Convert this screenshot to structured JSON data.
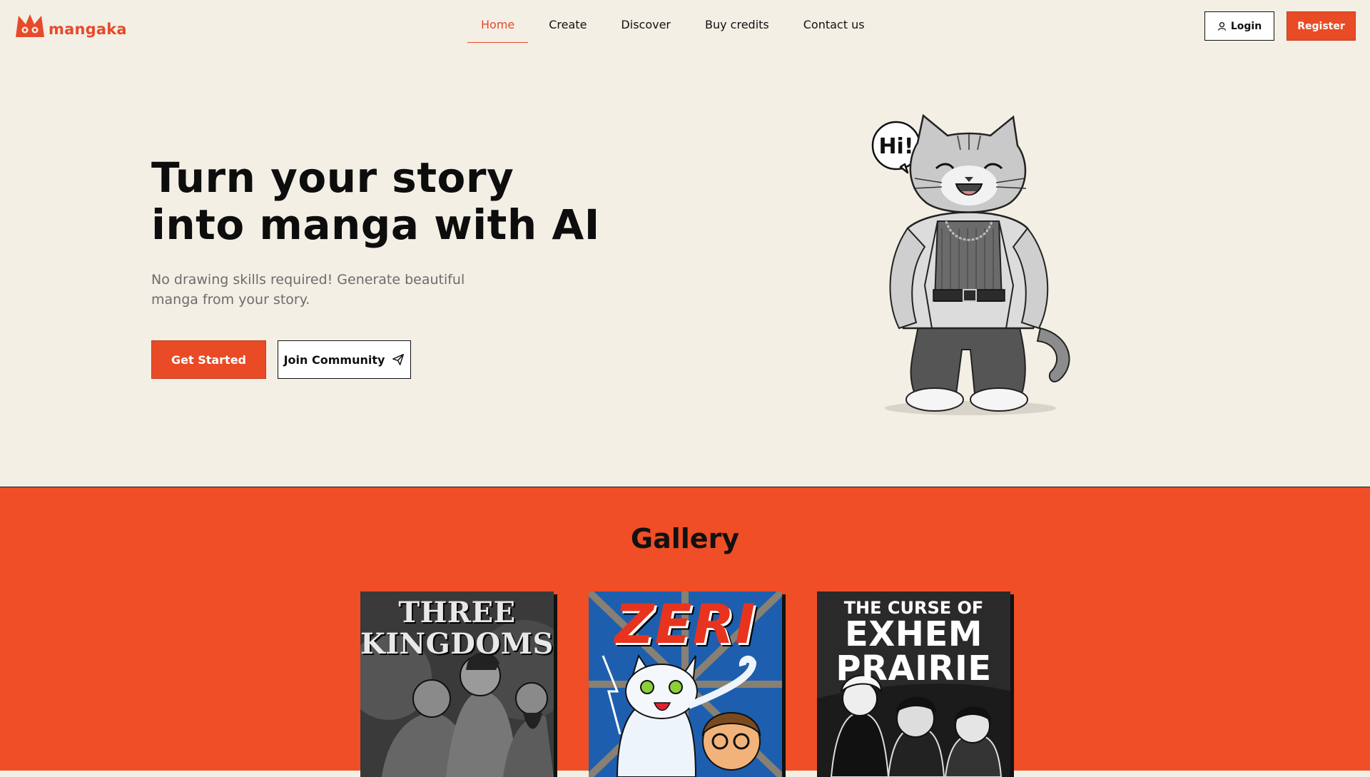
{
  "brand": {
    "name": "mangaka",
    "color": "#e8492a"
  },
  "nav": {
    "items": [
      {
        "label": "Home",
        "active": true
      },
      {
        "label": "Create",
        "active": false
      },
      {
        "label": "Discover",
        "active": false
      },
      {
        "label": "Buy credits",
        "active": false
      },
      {
        "label": "Contact us",
        "active": false
      }
    ]
  },
  "auth": {
    "login_label": "Login",
    "login_icon": "user-icon",
    "register_label": "Register"
  },
  "hero": {
    "title_line1": "Turn your story",
    "title_line2": "into manga with AI",
    "subtitle_line1": "No drawing skills required! Generate beautiful",
    "subtitle_line2": "manga from your story.",
    "primary_cta": "Get Started",
    "secondary_cta": "Join Community",
    "secondary_icon": "paper-plane-icon",
    "speech_bubble": "Hi!"
  },
  "gallery": {
    "title": "Gallery",
    "covers": [
      {
        "title_line1": "THREE",
        "title_line2": "KINGDOMS"
      },
      {
        "title": "ZERI"
      },
      {
        "title_top": "THE CURSE OF",
        "title_line1": "EXHEM",
        "title_line2": "PRAIRIE"
      }
    ]
  },
  "colors": {
    "accent": "#e94b26",
    "background": "#f3efe5",
    "gallery_bg": "#ef4e26"
  }
}
